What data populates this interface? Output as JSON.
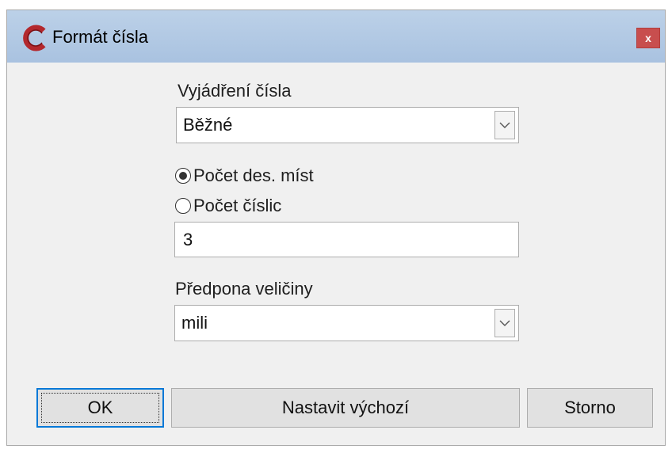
{
  "window": {
    "title": "Formát čísla",
    "close_label": "x",
    "logo_color": "#b3282d",
    "titlebar_color": "#b3cae5",
    "close_color": "#c84e4e"
  },
  "number_format": {
    "label": "Vyjádření čísla",
    "selected": "Běžné"
  },
  "precision_mode": {
    "options": [
      {
        "label": "Počet des. míst",
        "checked": true
      },
      {
        "label": "Počet číslic",
        "checked": false
      }
    ]
  },
  "precision_value": "3",
  "unit_prefix": {
    "label": "Předpona veličiny",
    "selected": "mili"
  },
  "buttons": {
    "ok": "OK",
    "set_default": "Nastavit výchozí",
    "cancel": "Storno"
  },
  "icons": {
    "app": "app-logo-icon",
    "close": "close-icon",
    "dropdown": "chevron-down-icon"
  }
}
